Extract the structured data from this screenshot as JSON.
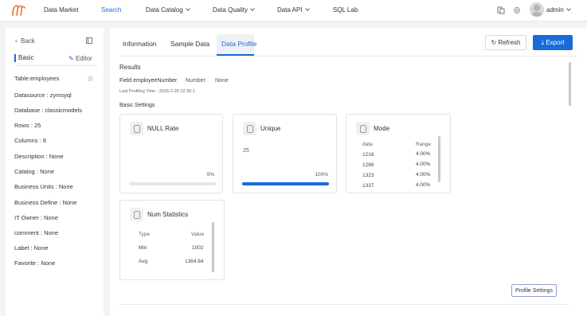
{
  "nav": {
    "items": [
      "Data Market",
      "Search",
      "Data Catalog",
      "Data Quality",
      "Data API",
      "SQL Lab"
    ],
    "active": "Search",
    "user": "admin"
  },
  "left": {
    "back": "Back",
    "section": "Basic",
    "editor": "Editor",
    "table": "Table:employees",
    "fields": [
      "Datasource : zymsyql",
      "Database : classicmodels",
      "Rows : 25",
      "Columns : 8",
      "Description : None",
      "Catalog : None",
      "Business Units : None",
      "Business Define : None",
      "IT Owner : None",
      "comment : None",
      "Label : None",
      "Favorite : None"
    ]
  },
  "main": {
    "tabs": [
      "Information",
      "Sample Data",
      "Data Profile"
    ],
    "active_tab": "Data Profile",
    "refresh": "Refresh",
    "export": "Export",
    "results": "Results",
    "field_label": "Field employeeNumber",
    "field_type": "Number",
    "field_none": "None",
    "last_time": "Last Profiling Time : 2025-2-26 22:30:1",
    "basic_settings": "Basic Settings",
    "null_rate": {
      "title": "NULL Rate",
      "pct": "0%",
      "fill": 0
    },
    "unique": {
      "title": "Unique",
      "value": "25",
      "pct": "100%",
      "fill": 100
    },
    "mode": {
      "title": "Mode",
      "headers": [
        "data",
        "Range"
      ],
      "rows": [
        [
          "1216",
          "4.00%"
        ],
        [
          "1286",
          "4.00%"
        ],
        [
          "1323",
          "4.00%"
        ],
        [
          "1337",
          "4.00%"
        ]
      ]
    },
    "num_stats": {
      "title": "Num Statistics",
      "headers": [
        "Type",
        "Value"
      ],
      "rows": [
        [
          "Min",
          "1002"
        ],
        [
          "Avg",
          "1364.84"
        ]
      ]
    },
    "profile_settings": "Profile Settings"
  },
  "colors": {
    "accent": "#1a6ad9",
    "logo": "#e8732c"
  }
}
